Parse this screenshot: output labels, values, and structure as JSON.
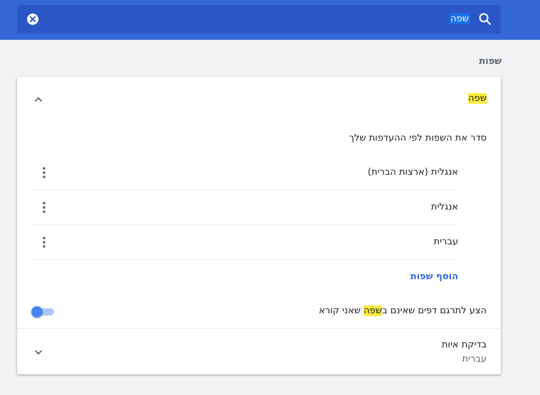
{
  "search": {
    "query": "שפה"
  },
  "section": {
    "title": "שפות"
  },
  "languages": {
    "header_label": "שפה",
    "order_heading": "סדר את השפות לפי ההעדפות שלך",
    "items": [
      {
        "label": "אנגלית (ארצות הברית)"
      },
      {
        "label": "אנגלית"
      },
      {
        "label": "עברית"
      }
    ],
    "add_label": "הוסף שפות",
    "offer_translate": {
      "before": "הצע לתרגם דפים שאינם ב",
      "highlight": "שפה",
      "after": " שאני קורא",
      "enabled": true
    }
  },
  "spellcheck": {
    "title": "בדיקת איות",
    "value": "עברית"
  },
  "icons": {
    "clear": "close-circle-icon",
    "search": "search-icon",
    "collapse": "chevron-up-icon",
    "expand": "chevron-down-icon",
    "more": "more-vert-icon"
  },
  "colors": {
    "topbar": "#3367d6",
    "searchbox": "#2a56c6",
    "highlight": "#fdeb3d",
    "link": "#3367d6",
    "toggle_on": "#4285f4"
  }
}
